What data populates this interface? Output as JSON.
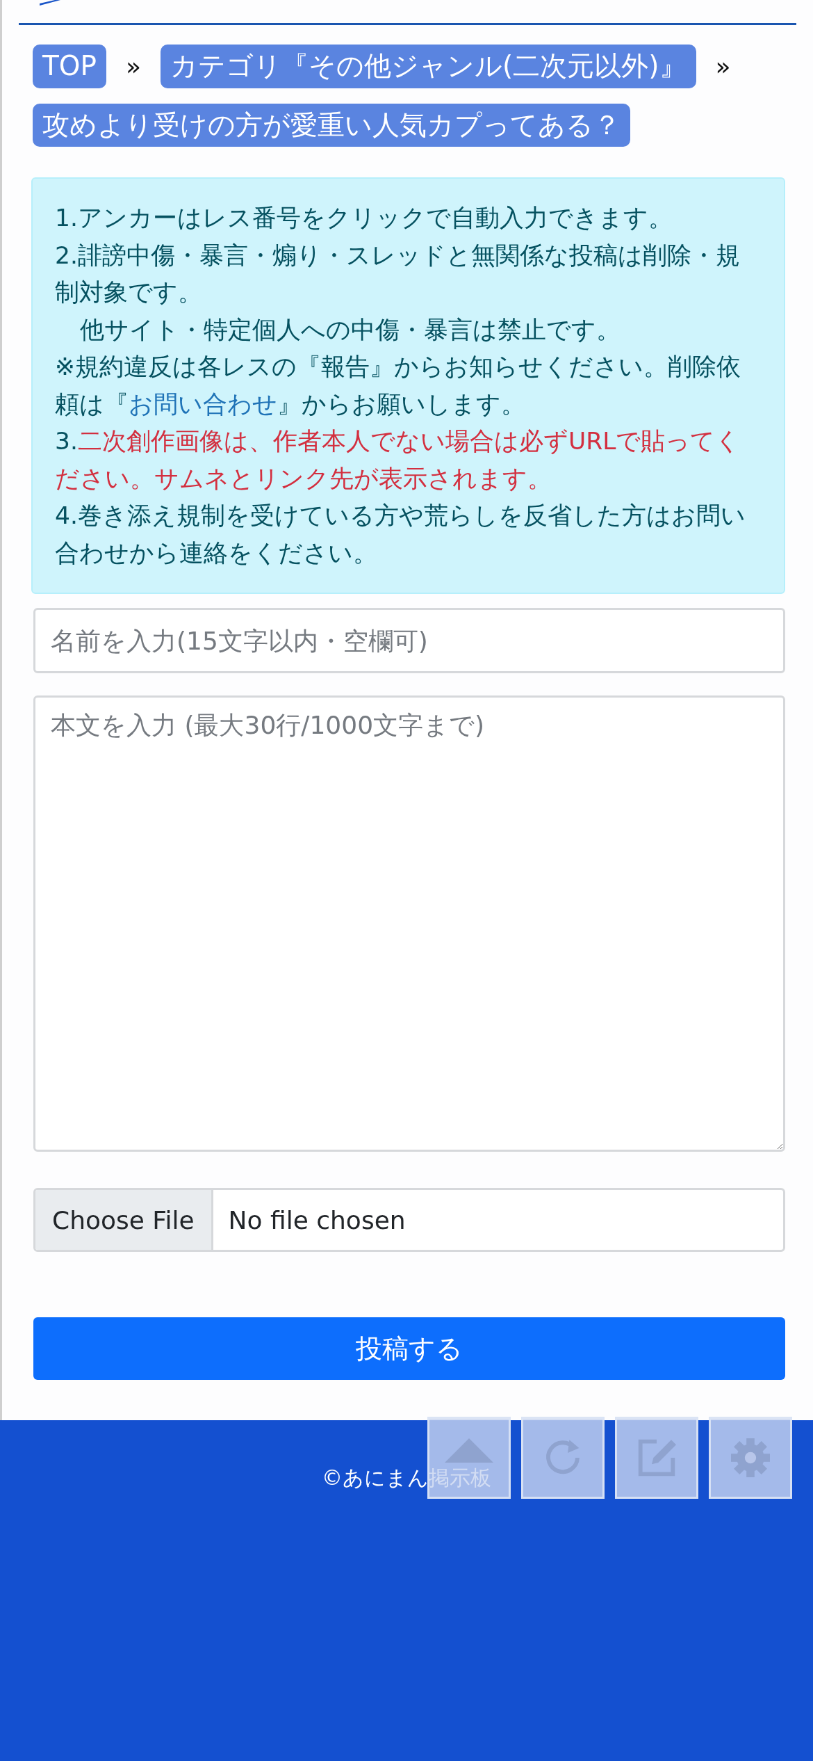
{
  "breadcrumb": [
    {
      "kind": "link",
      "text": "TOP"
    },
    {
      "kind": "separator",
      "text": "»"
    },
    {
      "kind": "link",
      "text": "カテゴリ『その他ジャンル(二次元以外)』"
    },
    {
      "kind": "separator",
      "text": "»"
    },
    {
      "kind": "link",
      "text": "攻めより受けの方が愛重い人気カプってある？"
    }
  ],
  "notice": [
    {
      "indented": false,
      "segments": [
        {
          "kind": "plain",
          "text": "1.アンカーはレス番号をクリックで自動入力できます。"
        }
      ]
    },
    {
      "indented": false,
      "segments": [
        {
          "kind": "plain",
          "text": "2.誹謗中傷・暴言・煽り・スレッドと無関係な投稿は削除・規制対象です。"
        }
      ]
    },
    {
      "indented": true,
      "segments": [
        {
          "kind": "plain",
          "text": "他サイト・特定個人への中傷・暴言は禁止です。"
        }
      ]
    },
    {
      "indented": false,
      "segments": [
        {
          "kind": "plain",
          "text": "※規約違反は各レスの『報告』からお知らせください。削除依頼は『"
        },
        {
          "kind": "link",
          "text": "お問い合わせ"
        },
        {
          "kind": "plain",
          "text": "』からお願いします。"
        }
      ]
    },
    {
      "indented": false,
      "segments": [
        {
          "kind": "plain",
          "text": "3."
        },
        {
          "kind": "warning",
          "text": "二次創作画像は、作者本人でない場合は必ずURLで貼ってください。サムネとリンク先が表示されます。"
        }
      ]
    },
    {
      "indented": false,
      "segments": [
        {
          "kind": "plain",
          "text": "4.巻き添え規制を受けている方や荒らしを反省した方はお問い合わせから連絡をください。"
        }
      ]
    }
  ],
  "form": {
    "name_field": {
      "placeholder": "名前を入力(15文字以内・空欄可)"
    },
    "body_field": {
      "placeholder": "本文を入力 (最大30行/1000文字まで)"
    },
    "file_field": {
      "button": "Choose File",
      "status": "No file chosen"
    },
    "submit_button": "投稿する"
  },
  "footer": {
    "copyright": "©あにまん掲示板"
  },
  "floating_buttons": [
    {
      "kind": "up"
    },
    {
      "kind": "reload"
    },
    {
      "kind": "edit"
    },
    {
      "kind": "settings"
    }
  ]
}
